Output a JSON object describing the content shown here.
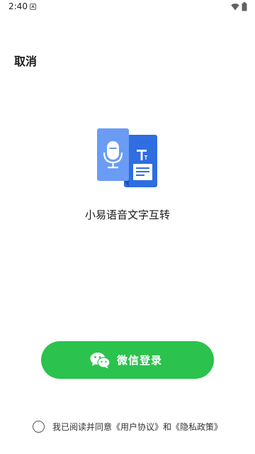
{
  "status_bar": {
    "time": "2:40",
    "icons": [
      "notification-icon",
      "wifi-icon",
      "battery-icon"
    ]
  },
  "header": {
    "cancel_label": "取消"
  },
  "app": {
    "name": "小易语音文字互转",
    "logo_icon": "voice-to-text-logo"
  },
  "login": {
    "wechat_label": "微信登录",
    "icon": "wechat-icon"
  },
  "agreement": {
    "prefix": "我已阅读并同意",
    "user_agreement": "《用户协议》",
    "joiner": "和",
    "privacy_policy": "《隐私政策》"
  },
  "colors": {
    "wechat_green": "#2bc24d",
    "logo_light_blue": "#6a9cf5",
    "logo_dark_blue": "#2f6de0",
    "background": "#ffffff"
  }
}
